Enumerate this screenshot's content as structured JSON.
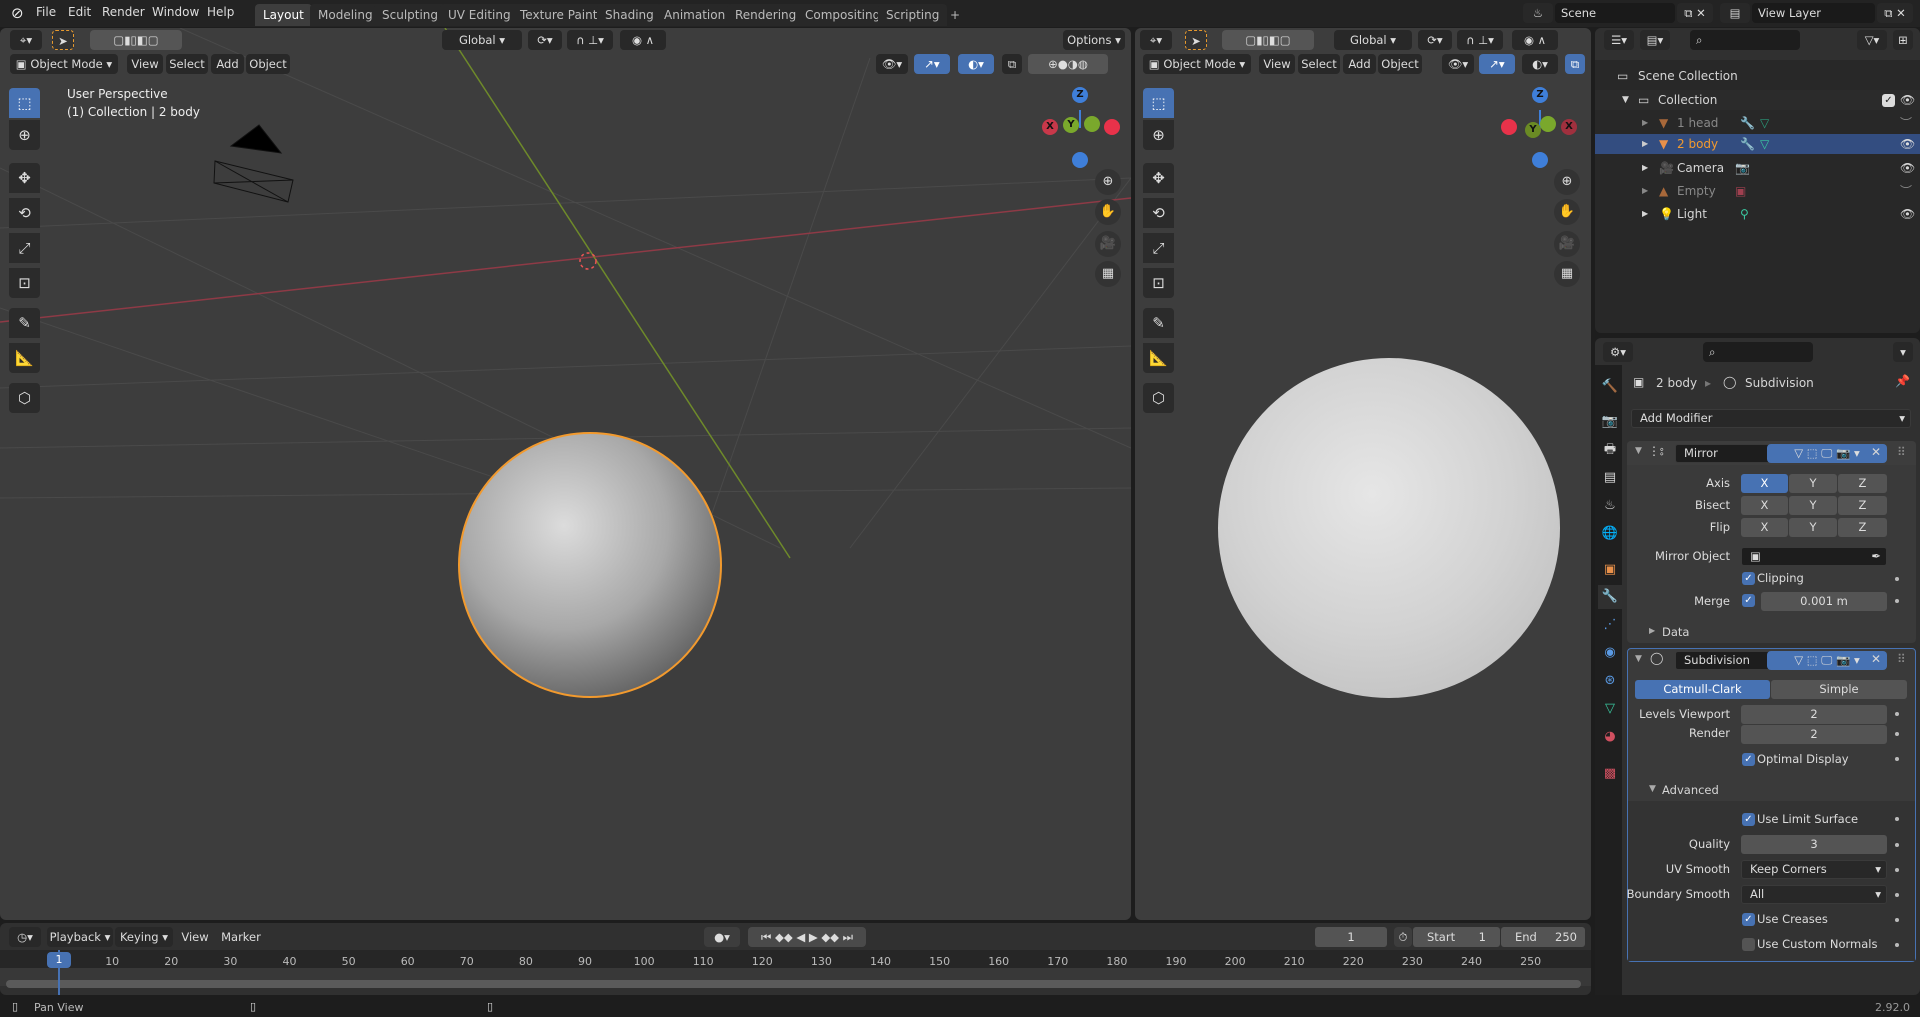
{
  "topbar": {
    "menus": [
      "File",
      "Edit",
      "Render",
      "Window",
      "Help"
    ],
    "tabs": [
      "Layout",
      "Modeling",
      "Sculpting",
      "UV Editing",
      "Texture Paint",
      "Shading",
      "Animation",
      "Rendering",
      "Compositing",
      "Scripting",
      "+"
    ],
    "active_tab": "Layout",
    "scene": "Scene",
    "view_layer": "View Layer"
  },
  "viewport_left": {
    "orientation": "Global",
    "options": "Options",
    "mode": "Object Mode",
    "menus": [
      "View",
      "Select",
      "Add",
      "Object"
    ],
    "info_line1": "User Perspective",
    "info_line2": "(1) Collection | 2 body",
    "gizmo": {
      "x": "X",
      "y": "Y",
      "z": "Z"
    }
  },
  "viewport_right": {
    "orientation": "Global",
    "mode": "Object Mode",
    "menus": [
      "View",
      "Select",
      "Add",
      "Object"
    ],
    "gizmo": {
      "x": "X",
      "y": "Y",
      "z": "Z"
    }
  },
  "outliner": {
    "scene_collection": "Scene Collection",
    "collection": "Collection",
    "items": [
      {
        "name": "1 head",
        "hidden": true,
        "selected": false
      },
      {
        "name": "2 body",
        "hidden": false,
        "selected": true
      },
      {
        "name": "Camera",
        "hidden": false,
        "selected": false
      },
      {
        "name": "Empty",
        "hidden": true,
        "selected": false
      },
      {
        "name": "Light",
        "hidden": false,
        "selected": false
      }
    ]
  },
  "properties": {
    "breadcrumb_object": "2 body",
    "breadcrumb_modifier": "Subdivision",
    "add_modifier": "Add Modifier",
    "mirror": {
      "name": "Mirror",
      "axis_label": "Axis",
      "bisect_label": "Bisect",
      "flip_label": "Flip",
      "xyz": [
        "X",
        "Y",
        "Z"
      ],
      "axis_active": "X",
      "mirror_object_label": "Mirror Object",
      "clipping_label": "Clipping",
      "clipping": true,
      "merge_label": "Merge",
      "merge": true,
      "merge_value": "0.001 m",
      "data_label": "Data"
    },
    "subdivision": {
      "name": "Subdivision",
      "type_options": [
        "Catmull-Clark",
        "Simple"
      ],
      "type_active": "Catmull-Clark",
      "levels_viewport_label": "Levels Viewport",
      "levels_viewport": "2",
      "render_label": "Render",
      "render": "2",
      "optimal_display_label": "Optimal Display",
      "optimal_display": true,
      "advanced_label": "Advanced",
      "use_limit_surface_label": "Use Limit Surface",
      "use_limit_surface": true,
      "quality_label": "Quality",
      "quality": "3",
      "uv_smooth_label": "UV Smooth",
      "uv_smooth": "Keep Corners",
      "boundary_smooth_label": "Boundary Smooth",
      "boundary_smooth": "All",
      "use_creases_label": "Use Creases",
      "use_creases": true,
      "use_custom_normals_label": "Use Custom Normals",
      "use_custom_normals": false
    }
  },
  "timeline": {
    "menus": [
      "Playback",
      "Keying",
      "View",
      "Marker"
    ],
    "current_frame": "1",
    "start_label": "Start",
    "start": "1",
    "end_label": "End",
    "end": "250",
    "ticks": [
      "1",
      "10",
      "20",
      "30",
      "40",
      "50",
      "60",
      "70",
      "80",
      "90",
      "100",
      "110",
      "120",
      "130",
      "140",
      "150",
      "160",
      "170",
      "180",
      "190",
      "200",
      "210",
      "220",
      "230",
      "240",
      "250"
    ]
  },
  "statusbar": {
    "hint": "Pan View",
    "version": "2.92.0"
  },
  "colors": {
    "accent": "#4772b3",
    "selection_outline": "#f29a2e",
    "x_axis": "#c8384a",
    "y_axis": "#7aa82c",
    "z_axis": "#3f7fd9"
  }
}
